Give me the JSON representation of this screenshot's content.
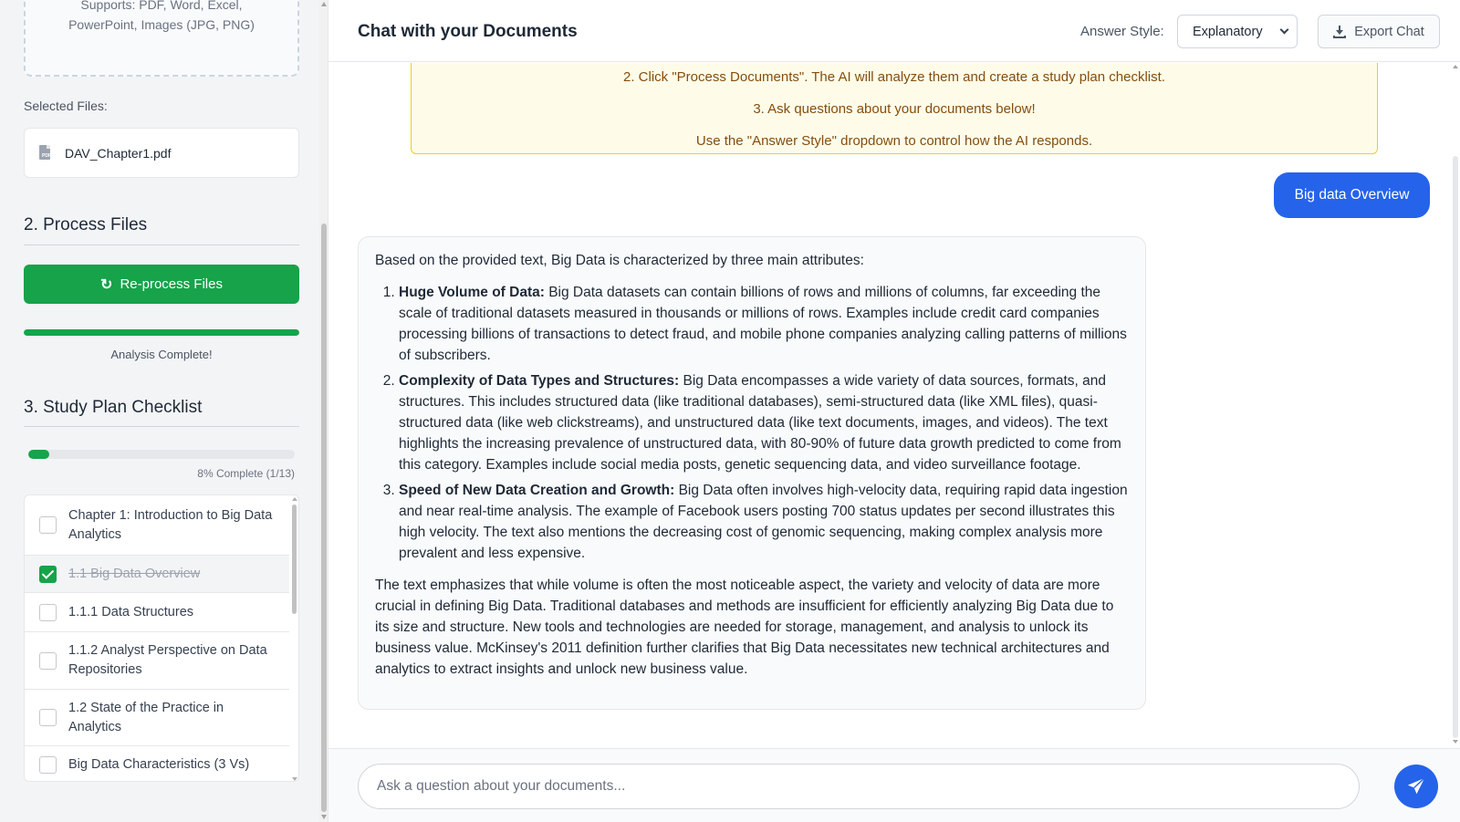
{
  "sidebar": {
    "upload": {
      "supports_line1": "Supports: PDF, Word, Excel,",
      "supports_line2": "PowerPoint, Images (JPG, PNG)"
    },
    "selected_files_label": "Selected Files:",
    "files": [
      {
        "name": "DAV_Chapter1.pdf",
        "icon": "pdf-file-icon"
      }
    ],
    "process": {
      "heading": "2. Process Files",
      "button_label": "Re-process Files",
      "button_icon": "refresh-icon",
      "progress_fraction": 1.0,
      "status": "Analysis Complete!"
    },
    "study_plan": {
      "heading": "3. Study Plan Checklist",
      "progress_fraction": 0.08,
      "progress_text": "8% Complete (1/13)",
      "items": [
        {
          "label": "Chapter 1: Introduction to Big Data Analytics",
          "checked": false
        },
        {
          "label": "1.1 Big Data Overview",
          "checked": true
        },
        {
          "label": "1.1.1 Data Structures",
          "checked": false
        },
        {
          "label": "1.1.2 Analyst Perspective on Data Repositories",
          "checked": false
        },
        {
          "label": "1.2 State of the Practice in Analytics",
          "checked": false
        },
        {
          "label": "Big Data Characteristics (3 Vs)",
          "checked": false
        }
      ]
    }
  },
  "header": {
    "title": "Chat with your Documents",
    "answer_style_label": "Answer Style:",
    "answer_style_value": "Explanatory",
    "export_label": "Export Chat",
    "export_icon": "download-icon"
  },
  "chat": {
    "welcome_lines": [
      "2. Click \"Process Documents\". The AI will analyze them and create a study plan checklist.",
      "3. Ask questions about your documents below!",
      "Use the \"Answer Style\" dropdown to control how the AI responds."
    ],
    "user_message": "Big data Overview",
    "ai_response": {
      "intro": "Based on the provided text, Big Data is characterized by three main attributes:",
      "points": [
        {
          "title": "Huge Volume of Data:",
          "text": " Big Data datasets can contain billions of rows and millions of columns, far exceeding the scale of traditional datasets measured in thousands or millions of rows. Examples include credit card companies processing billions of transactions to detect fraud, and mobile phone companies analyzing calling patterns of millions of subscribers."
        },
        {
          "title": "Complexity of Data Types and Structures:",
          "text": " Big Data encompasses a wide variety of data sources, formats, and structures. This includes structured data (like traditional databases), semi-structured data (like XML files), quasi-structured data (like web clickstreams), and unstructured data (like text documents, images, and videos). The text highlights the increasing prevalence of unstructured data, with 80-90% of future data growth predicted to come from this category. Examples include social media posts, genetic sequencing data, and video surveillance footage."
        },
        {
          "title": "Speed of New Data Creation and Growth:",
          "text": " Big Data often involves high-velocity data, requiring rapid data ingestion and near real-time analysis. The example of Facebook users posting 700 status updates per second illustrates this high velocity. The text also mentions the decreasing cost of genomic sequencing, making complex analysis more prevalent and less expensive."
        }
      ],
      "conclusion": "The text emphasizes that while volume is often the most noticeable aspect, the variety and velocity of data are more crucial in defining Big Data. Traditional databases and methods are insufficient for efficiently analyzing Big Data due to its size and structure. New tools and technologies are needed for storage, management, and analysis to unlock its business value. McKinsey's 2011 definition further clarifies that Big Data necessitates new technical architectures and analytics to extract insights and unlock new business value."
    },
    "input_placeholder": "Ask a question about your documents...",
    "send_icon": "paper-plane-icon"
  },
  "colors": {
    "accent_green": "#16a34a",
    "accent_blue": "#2563eb",
    "notice_bg": "#fefce8",
    "notice_border": "#facc15"
  }
}
